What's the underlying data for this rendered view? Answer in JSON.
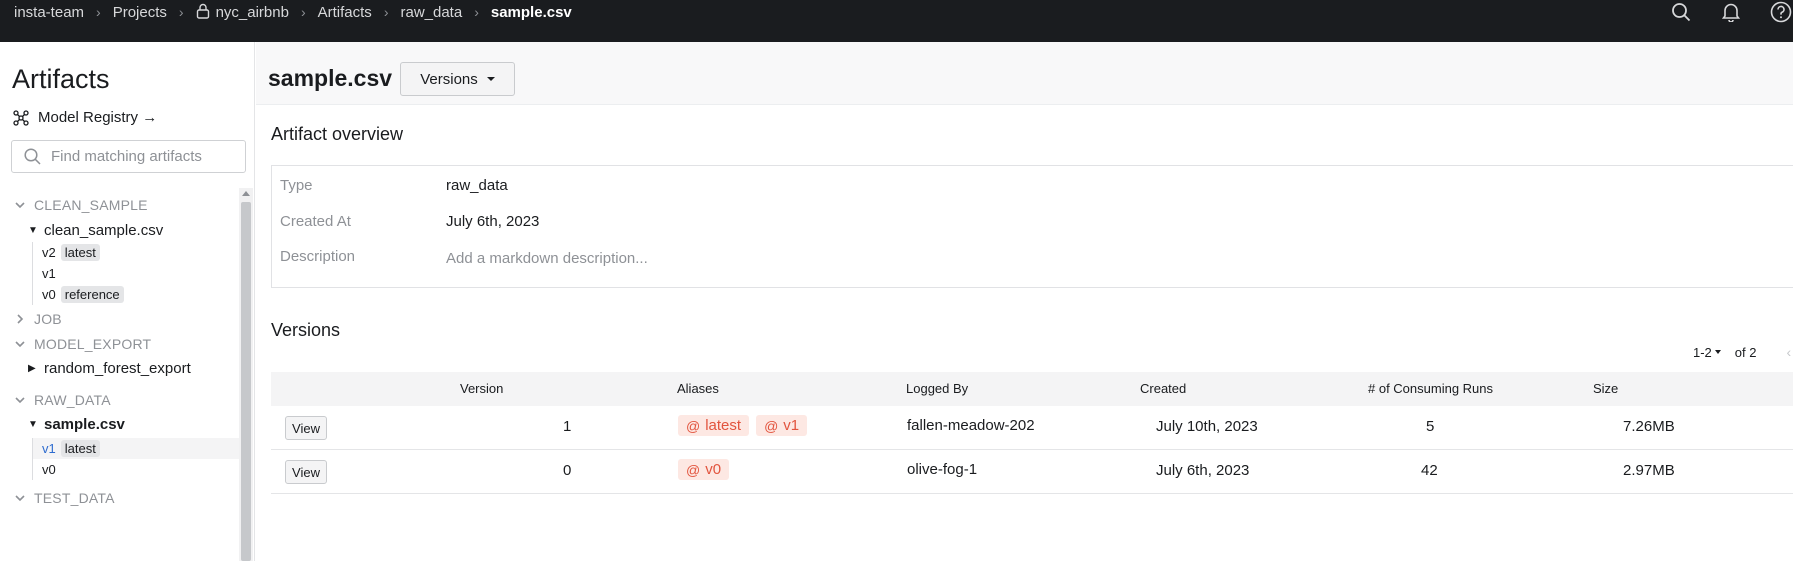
{
  "breadcrumbs": [
    "insta-team",
    "Projects",
    "nyc_airbnb",
    "Artifacts",
    "raw_data",
    "sample.csv"
  ],
  "sidebar": {
    "title": "Artifacts",
    "model_registry": "Model Registry →",
    "search_placeholder": "Find matching artifacts",
    "categories": {
      "clean_sample": "CLEAN_SAMPLE",
      "job": "JOB",
      "model_export": "MODEL_EXPORT",
      "raw_data": "RAW_DATA",
      "test_data": "TEST_DATA"
    },
    "artifacts": {
      "clean_sample_csv": "clean_sample.csv",
      "random_forest_export": "random_forest_export",
      "sample_csv": "sample.csv"
    },
    "clean_sample_versions": [
      {
        "version": "v2",
        "alias": "latest"
      },
      {
        "version": "v1",
        "alias": ""
      },
      {
        "version": "v0",
        "alias": "reference"
      }
    ],
    "sample_versions": [
      {
        "version": "v1",
        "alias": "latest"
      },
      {
        "version": "v0",
        "alias": ""
      }
    ]
  },
  "main": {
    "title": "sample.csv",
    "versions_button": "Versions",
    "overview_title": "Artifact overview",
    "overview": {
      "type_label": "Type",
      "type_value": "raw_data",
      "created_label": "Created At",
      "created_value": "July 6th, 2023",
      "description_label": "Description",
      "description_placeholder": "Add a markdown description..."
    },
    "versions_title": "Versions",
    "pager": {
      "range": "1-2",
      "of": "of 2"
    },
    "table": {
      "headers": [
        "Version",
        "Aliases",
        "Logged By",
        "Created",
        "# of Consuming Runs",
        "Size"
      ],
      "view_label": "View",
      "rows": [
        {
          "version": "1",
          "aliases": [
            "latest",
            "v1"
          ],
          "logged_by": "fallen-meadow-202",
          "created": "July 10th, 2023",
          "runs": "5",
          "size": "7.26MB"
        },
        {
          "version": "0",
          "aliases": [
            "v0"
          ],
          "logged_by": "olive-fog-1",
          "created": "July 6th, 2023",
          "runs": "42",
          "size": "2.97MB"
        }
      ]
    }
  },
  "colors": {
    "topbar": "#1a1c1f",
    "alias_bg": "#fde8e3",
    "alias_text": "#e2543e",
    "selected_version": "#2e6ccf"
  },
  "icons": [
    "lock-icon",
    "search-icon",
    "bell-icon",
    "help-icon",
    "model-registry-icon"
  ]
}
